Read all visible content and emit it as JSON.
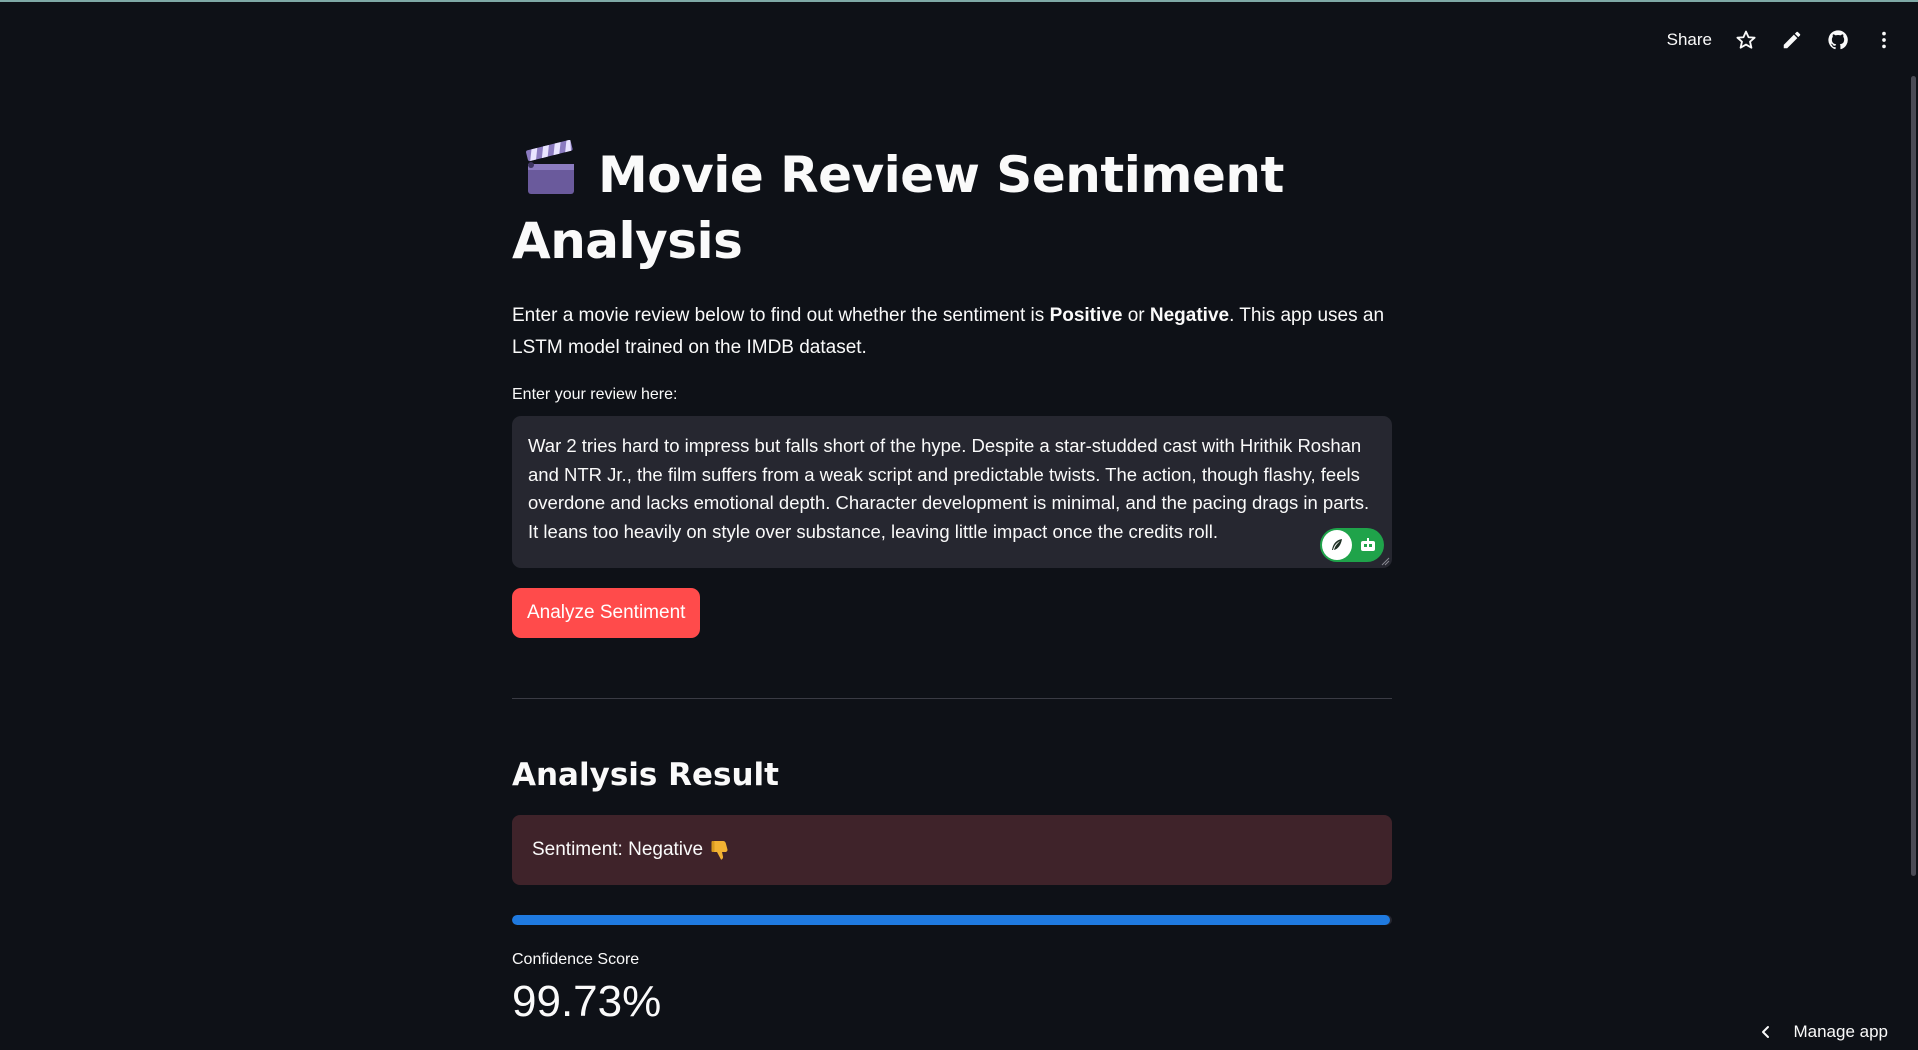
{
  "toolbar": {
    "share_label": "Share",
    "icons": [
      "star-icon",
      "pencil-icon",
      "github-icon",
      "more-vertical-icon"
    ]
  },
  "header": {
    "title_icon": "clapperboard-icon",
    "title": "Movie Review Sentiment Analysis"
  },
  "intro": {
    "text_before": "Enter a movie review below to find out whether the sentiment is ",
    "positive": "Positive",
    "or": " or ",
    "negative": "Negative",
    "text_after": ". This app uses an LSTM model trained on the IMDB dataset."
  },
  "review": {
    "label": "Enter your review here:",
    "value": "War 2 tries hard to impress but falls short of the hype. Despite a star-studded cast with Hrithik Roshan and NTR Jr., the film suffers from a weak script and predictable twists. The action, though flashy, feels overdone and lacks emotional depth. Character development is minimal, and the pacing drags in parts. It leans too heavily on style over substance, leaving little impact once the credits roll."
  },
  "analyze_button": {
    "label": "Analyze Sentiment"
  },
  "result": {
    "heading": "Analysis Result",
    "sentiment_text": "Sentiment: Negative",
    "sentiment_icon": "thumbs-down-icon",
    "progress_fraction": 0.9973,
    "metric_label": "Confidence Score",
    "metric_value": "99.73%"
  },
  "footer": {
    "manage_app_label": "Manage app"
  },
  "colors": {
    "background": "#0e1117",
    "primary_button": "#ff4b4b",
    "negative_box": "#3f232a",
    "progress": "#1f7ae0",
    "input_bg": "#262730"
  }
}
